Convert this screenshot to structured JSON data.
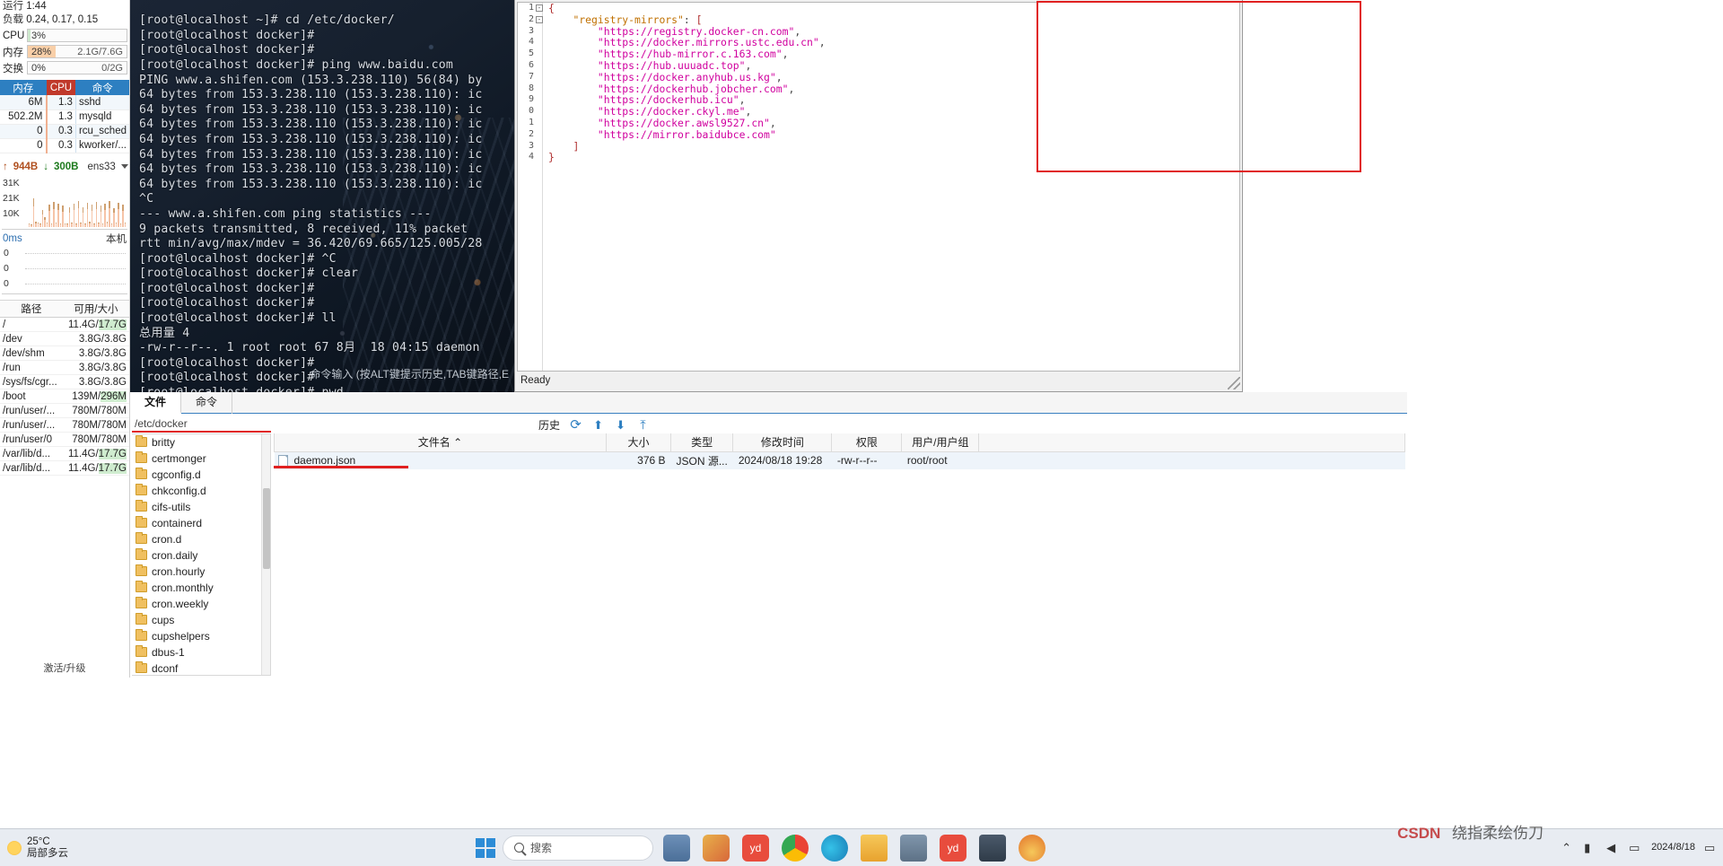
{
  "sidebar": {
    "uptime": {
      "label": "运行",
      "value": "1:44"
    },
    "load": {
      "label": "负载",
      "value": "0.24, 0.17, 0.15"
    },
    "meters": [
      {
        "name": "cpu",
        "label": "CPU",
        "pct": "3%",
        "fill": 3,
        "sub": "",
        "color": "#cde8cd"
      },
      {
        "name": "mem",
        "label": "内存",
        "pct": "28%",
        "fill": 28,
        "sub": "2.1G/7.6G",
        "color": "#f8cfa8"
      },
      {
        "name": "swap",
        "label": "交换",
        "pct": "0%",
        "fill": 0,
        "sub": "0/2G",
        "color": "#cde8cd"
      }
    ],
    "proc_headers": {
      "mem": "内存",
      "cpu": "CPU",
      "cmd": "命令"
    },
    "processes": [
      {
        "mem": "6M",
        "cpu": "1.3",
        "cmd": "sshd"
      },
      {
        "mem": "502.2M",
        "cpu": "1.3",
        "cmd": "mysqld"
      },
      {
        "mem": "0",
        "cpu": "0.3",
        "cmd": "rcu_sched"
      },
      {
        "mem": "0",
        "cpu": "0.3",
        "cmd": "kworker/..."
      }
    ],
    "network": {
      "up": "944B",
      "down": "300B",
      "iface": "ens33",
      "yticks": [
        "31K",
        "21K",
        "10K"
      ]
    },
    "latency": {
      "value": "0ms",
      "host": "本机",
      "yticks": [
        "0",
        "0",
        "0"
      ]
    },
    "disk_headers": {
      "path": "路径",
      "size": "可用/大小"
    },
    "disks": [
      {
        "path": "/",
        "size": "11.4G/17.7G"
      },
      {
        "path": "/dev",
        "size": "3.8G/3.8G"
      },
      {
        "path": "/dev/shm",
        "size": "3.8G/3.8G"
      },
      {
        "path": "/run",
        "size": "3.8G/3.8G"
      },
      {
        "path": "/sys/fs/cgr...",
        "size": "3.8G/3.8G"
      },
      {
        "path": "/boot",
        "size": "139M/296M"
      },
      {
        "path": "/run/user/...",
        "size": "780M/780M"
      },
      {
        "path": "/run/user/...",
        "size": "780M/780M"
      },
      {
        "path": "/run/user/0",
        "size": "780M/780M"
      },
      {
        "path": "/var/lib/d...",
        "size": "11.4G/17.7G"
      },
      {
        "path": "/var/lib/d...",
        "size": "11.4G/17.7G"
      }
    ],
    "activate_text": "激活/升级"
  },
  "terminal": {
    "content": "[root@localhost ~]# cd /etc/docker/\n[root@localhost docker]#\n[root@localhost docker]#\n[root@localhost docker]# ping www.baidu.com\nPING www.a.shifen.com (153.3.238.110) 56(84) by\n64 bytes from 153.3.238.110 (153.3.238.110): ic\n64 bytes from 153.3.238.110 (153.3.238.110): ic\n64 bytes from 153.3.238.110 (153.3.238.110): ic\n64 bytes from 153.3.238.110 (153.3.238.110): ic\n64 bytes from 153.3.238.110 (153.3.238.110): ic\n64 bytes from 153.3.238.110 (153.3.238.110): ic\n64 bytes from 153.3.238.110 (153.3.238.110): ic\n^C\n--- www.a.shifen.com ping statistics ---\n9 packets transmitted, 8 received, 11% packet\nrtt min/avg/max/mdev = 36.420/69.665/125.005/28\n[root@localhost docker]# ^C\n[root@localhost docker]# clear\n[root@localhost docker]#\n[root@localhost docker]#\n[root@localhost docker]# ll\n总用量 4\n-rw-r--r--. 1 root root 67 8月  18 04:15 daemon\n[root@localhost docker]#\n[root@localhost docker]#\n[root@localhost docker]# pwd",
    "input_hint": "命令输入 (按ALT键提示历史,TAB键路径,E"
  },
  "editor": {
    "status": "Ready",
    "line_numbers": [
      "1",
      "2",
      "3",
      "4",
      "5",
      "6",
      "7",
      "8",
      "9",
      "0",
      "1",
      "2",
      "3",
      "4"
    ],
    "lines": [
      {
        "indent": 0,
        "parts": [
          {
            "t": "brace",
            "v": "{"
          }
        ]
      },
      {
        "indent": 1,
        "parts": [
          {
            "t": "key",
            "v": "\"registry-mirrors\""
          },
          {
            "t": "punct",
            "v": ": "
          },
          {
            "t": "brace",
            "v": "["
          }
        ]
      },
      {
        "indent": 2,
        "parts": [
          {
            "t": "str",
            "v": "\"https://registry.docker-cn.com\""
          },
          {
            "t": "punct",
            "v": ","
          }
        ]
      },
      {
        "indent": 2,
        "parts": [
          {
            "t": "str",
            "v": "\"https://docker.mirrors.ustc.edu.cn\""
          },
          {
            "t": "punct",
            "v": ","
          }
        ]
      },
      {
        "indent": 2,
        "parts": [
          {
            "t": "str",
            "v": "\"https://hub-mirror.c.163.com\""
          },
          {
            "t": "punct",
            "v": ","
          }
        ]
      },
      {
        "indent": 2,
        "parts": [
          {
            "t": "str",
            "v": "\"https://hub.uuuadc.top\""
          },
          {
            "t": "punct",
            "v": ","
          }
        ]
      },
      {
        "indent": 2,
        "parts": [
          {
            "t": "str",
            "v": "\"https://docker.anyhub.us.kg\""
          },
          {
            "t": "punct",
            "v": ","
          }
        ]
      },
      {
        "indent": 2,
        "parts": [
          {
            "t": "str",
            "v": "\"https://dockerhub.jobcher.com\""
          },
          {
            "t": "punct",
            "v": ","
          }
        ]
      },
      {
        "indent": 2,
        "parts": [
          {
            "t": "str",
            "v": "\"https://dockerhub.icu\""
          },
          {
            "t": "punct",
            "v": ","
          }
        ]
      },
      {
        "indent": 2,
        "parts": [
          {
            "t": "str",
            "v": "\"https://docker.ckyl.me\""
          },
          {
            "t": "punct",
            "v": ","
          }
        ]
      },
      {
        "indent": 2,
        "parts": [
          {
            "t": "str",
            "v": "\"https://docker.awsl9527.cn\""
          },
          {
            "t": "punct",
            "v": ","
          }
        ]
      },
      {
        "indent": 2,
        "parts": [
          {
            "t": "str",
            "v": "\"https://mirror.baidubce.com\""
          }
        ]
      },
      {
        "indent": 1,
        "parts": [
          {
            "t": "brace",
            "v": "]"
          }
        ]
      },
      {
        "indent": 0,
        "parts": [
          {
            "t": "brace",
            "v": "}"
          }
        ]
      }
    ]
  },
  "filemanager": {
    "tabs": [
      {
        "name": "files",
        "label": "文件",
        "active": true
      },
      {
        "name": "commands",
        "label": "命令",
        "active": false
      }
    ],
    "path": "/etc/docker",
    "toolbar": {
      "history_label": "历史",
      "icons": [
        "refresh-icon",
        "download-icon",
        "upload-icon",
        "upload-to-server-icon"
      ]
    },
    "tree": [
      "britty",
      "certmonger",
      "cgconfig.d",
      "chkconfig.d",
      "cifs-utils",
      "containerd",
      "cron.d",
      "cron.daily",
      "cron.hourly",
      "cron.monthly",
      "cron.weekly",
      "cups",
      "cupshelpers",
      "dbus-1",
      "dconf"
    ],
    "columns": [
      "文件名",
      "大小",
      "类型",
      "修改时间",
      "权限",
      "用户/用户组"
    ],
    "files": [
      {
        "name": "daemon.json",
        "size": "376 B",
        "type": "JSON 源...",
        "mtime": "2024/08/18 19:28",
        "perm": "-rw-r--r--",
        "owner": "root/root"
      }
    ]
  },
  "taskbar": {
    "weather": {
      "temp": "25°C",
      "desc": "局部多云"
    },
    "search_placeholder": "搜索",
    "apps": [
      {
        "name": "windows-start-icon",
        "color": "#2d8cd6"
      },
      {
        "name": "search-icon",
        "color": "#ffffff"
      },
      {
        "name": "taskview-icon",
        "color": "#5b7fa8"
      },
      {
        "name": "widgets-icon",
        "color": "#d87a3a"
      },
      {
        "name": "yd-dictionary-icon",
        "color": "#e84c3d"
      },
      {
        "name": "chrome-icon",
        "color": "#4285f4"
      },
      {
        "name": "edge-icon",
        "color": "#2aa8d8"
      },
      {
        "name": "explorer-icon",
        "color": "#f2b134"
      },
      {
        "name": "terminal-icon",
        "color": "#6a7b8c"
      },
      {
        "name": "yd-note-icon",
        "color": "#e84c3d"
      },
      {
        "name": "monitor-icon",
        "color": "#3b4a5a"
      },
      {
        "name": "flame-icon",
        "color": "#e8a33d"
      }
    ],
    "watermark": "绕指柔绘伤刀",
    "watermark_brand": "CSDN",
    "date": "2024/8/18"
  }
}
